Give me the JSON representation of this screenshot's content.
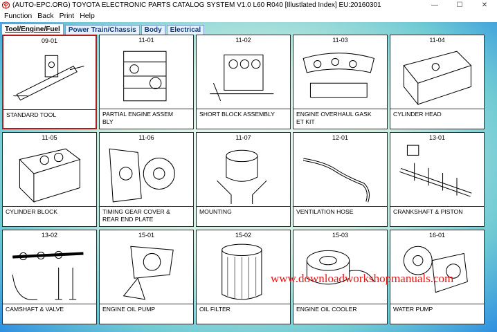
{
  "window": {
    "title": "(AUTO-EPC.ORG) TOYOTA ELECTRONIC PARTS CATALOG SYSTEM V1.0 L60 R040 [Illustlated Index] EU:20160301",
    "minimize": "—",
    "maximize": "☐",
    "close": "✕"
  },
  "menu": [
    "Function",
    "Back",
    "Print",
    "Help"
  ],
  "tabs": [
    {
      "label": "Tool/Engine/Fuel",
      "active": true
    },
    {
      "label": "Power Train/Chassis",
      "active": false
    },
    {
      "label": "Body",
      "active": false
    },
    {
      "label": "Electrical",
      "active": false
    }
  ],
  "parts": [
    {
      "code": "09-01",
      "label": "STANDARD TOOL",
      "icon": "jack-icon",
      "selected": true
    },
    {
      "code": "11-01",
      "label": "PARTIAL ENGINE ASSEM\nBLY",
      "icon": "engine-assembly-icon"
    },
    {
      "code": "11-02",
      "label": "SHORT BLOCK ASSEMBLY",
      "icon": "short-block-icon"
    },
    {
      "code": "11-03",
      "label": "ENGINE OVERHAUL GASK\nET KIT",
      "icon": "gasket-kit-icon"
    },
    {
      "code": "11-04",
      "label": "CYLINDER HEAD",
      "icon": "cylinder-head-icon"
    },
    {
      "code": "11-05",
      "label": "CYLINDER BLOCK",
      "icon": "cylinder-block-icon"
    },
    {
      "code": "11-06",
      "label": "TIMING GEAR COVER &\nREAR END PLATE",
      "icon": "timing-cover-icon"
    },
    {
      "code": "11-07",
      "label": "MOUNTING",
      "icon": "engine-mount-icon"
    },
    {
      "code": "12-01",
      "label": "VENTILATION HOSE",
      "icon": "hose-icon"
    },
    {
      "code": "13-01",
      "label": "CRANKSHAFT & PISTON",
      "icon": "crankshaft-icon"
    },
    {
      "code": "13-02",
      "label": "CAMSHAFT & VALVE",
      "icon": "camshaft-icon"
    },
    {
      "code": "15-01",
      "label": "ENGINE OIL PUMP",
      "icon": "oil-pump-icon"
    },
    {
      "code": "15-02",
      "label": "OIL FILTER",
      "icon": "oil-filter-icon"
    },
    {
      "code": "15-03",
      "label": "ENGINE OIL COOLER",
      "icon": "oil-cooler-icon"
    },
    {
      "code": "16-01",
      "label": "WATER PUMP",
      "icon": "water-pump-icon"
    }
  ],
  "watermark": "www.downloadworkshopmanuals.com",
  "colors": {
    "selected_border": "#b01c1c",
    "watermark": "#e01818",
    "tab_text": "#123a7a"
  }
}
